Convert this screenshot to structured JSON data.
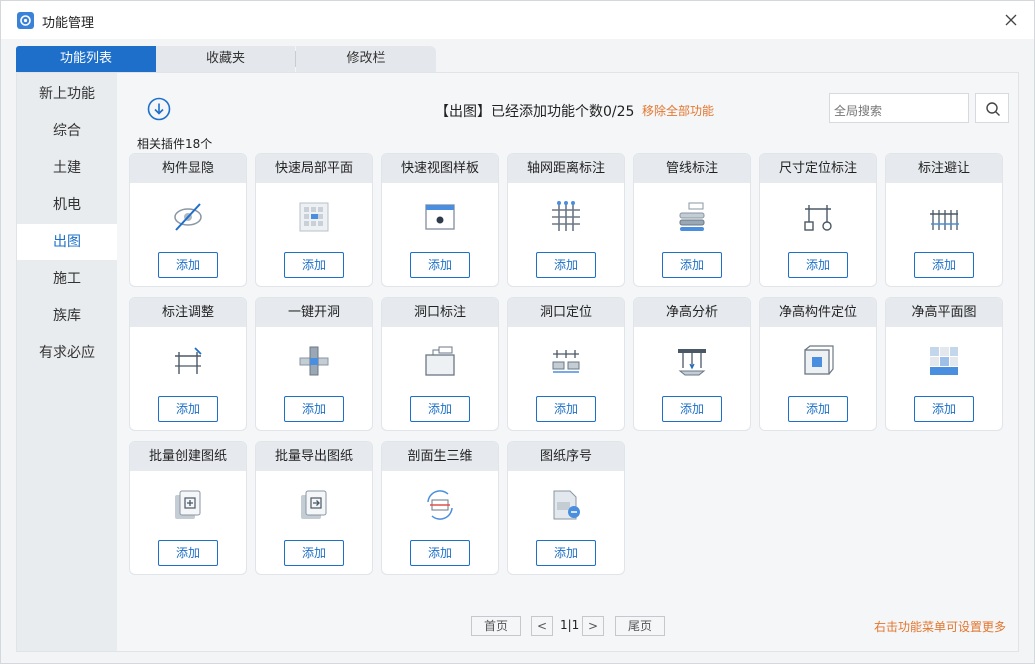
{
  "window": {
    "title": "功能管理"
  },
  "tabs": [
    "功能列表",
    "收藏夹",
    "修改栏"
  ],
  "sidebar": [
    "新上功能",
    "综合",
    "土建",
    "机电",
    "出图",
    "施工",
    "族库",
    "有求必应"
  ],
  "header": {
    "status_text": "【出图】已经添加功能个数0/25",
    "remove_all": "移除全部功能",
    "search_placeholder": "全局搜索",
    "plugin_count": "相关插件18个"
  },
  "add_label": "添加",
  "cards": [
    {
      "title": "构件显隐",
      "icon": "eye-slash-icon"
    },
    {
      "title": "快速局部平面",
      "icon": "local-plan-icon"
    },
    {
      "title": "快速视图样板",
      "icon": "view-template-icon"
    },
    {
      "title": "轴网距离标注",
      "icon": "grid-dimension-icon"
    },
    {
      "title": "管线标注",
      "icon": "pipe-tag-icon"
    },
    {
      "title": "尺寸定位标注",
      "icon": "dimension-locate-icon"
    },
    {
      "title": "标注避让",
      "icon": "tag-avoid-icon"
    },
    {
      "title": "标注调整",
      "icon": "tag-adjust-icon"
    },
    {
      "title": "一键开洞",
      "icon": "open-hole-icon"
    },
    {
      "title": "洞口标注",
      "icon": "opening-tag-icon"
    },
    {
      "title": "洞口定位",
      "icon": "opening-locate-icon"
    },
    {
      "title": "净高分析",
      "icon": "clear-height-icon"
    },
    {
      "title": "净高构件定位",
      "icon": "height-element-locate-icon"
    },
    {
      "title": "净高平面图",
      "icon": "height-plan-icon"
    },
    {
      "title": "批量创建图纸",
      "icon": "batch-create-sheet-icon"
    },
    {
      "title": "批量导出图纸",
      "icon": "batch-export-sheet-icon"
    },
    {
      "title": "剖面生三维",
      "icon": "section-3d-icon"
    },
    {
      "title": "图纸序号",
      "icon": "sheet-number-icon"
    }
  ],
  "pagination": {
    "first": "首页",
    "prev": "<",
    "page": "1|1",
    "next": ">",
    "last": "尾页"
  },
  "footer_hint": "右击功能菜单可设置更多"
}
